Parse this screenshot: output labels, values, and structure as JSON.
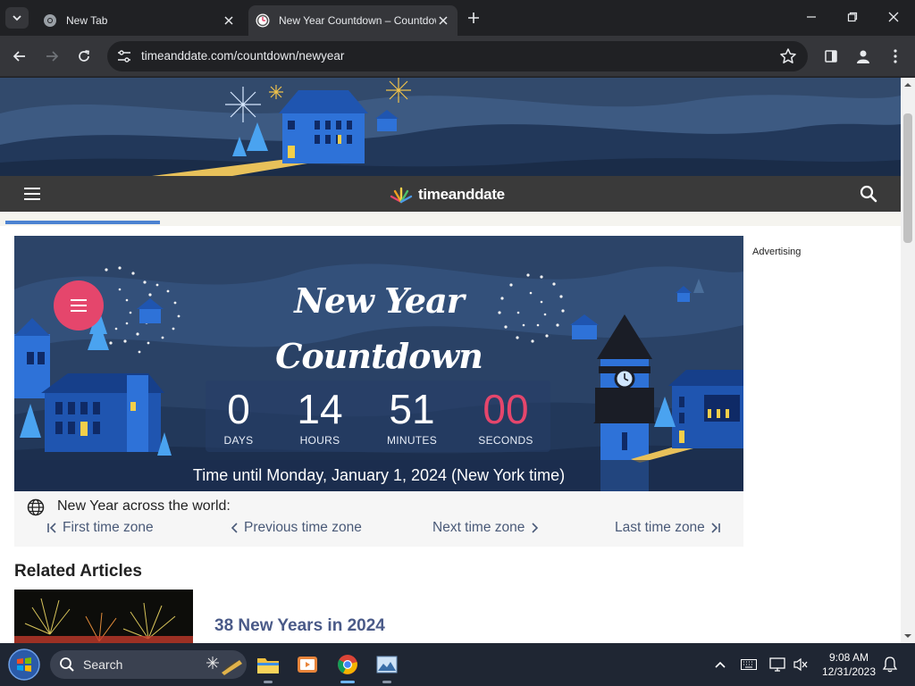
{
  "browser": {
    "tabs": [
      {
        "title": "New Tab",
        "active": false
      },
      {
        "title": "New Year Countdown – Countdown to New Year",
        "active": true
      }
    ],
    "url": "timeanddate.com/countdown/newyear"
  },
  "site": {
    "logo_text": "timeanddate"
  },
  "countdown": {
    "title_line1": "New Year",
    "title_line2": "Countdown",
    "days": "0",
    "days_label": "DAYS",
    "hours": "14",
    "hours_label": "HOURS",
    "minutes": "51",
    "minutes_label": "MINUTES",
    "seconds": "00",
    "seconds_label": "SECONDS",
    "footer": "Time until Monday, January 1, 2024 (New York time)"
  },
  "sidebar": {
    "advertising": "Advertising"
  },
  "world": {
    "title": "New Year across the world:",
    "first": "First time zone",
    "previous": "Previous time zone",
    "next": "Next time zone",
    "last": "Last time zone"
  },
  "related": {
    "heading": "Related Articles",
    "articles": [
      {
        "title": "38 New Years in 2024"
      }
    ]
  },
  "taskbar": {
    "search_label": "Search",
    "time": "9:08 AM",
    "date": "12/31/2023"
  },
  "colors": {
    "accent_pink": "#e5466c",
    "nav_dark": "#3a3a3a",
    "link_blue": "#4a5a88"
  }
}
